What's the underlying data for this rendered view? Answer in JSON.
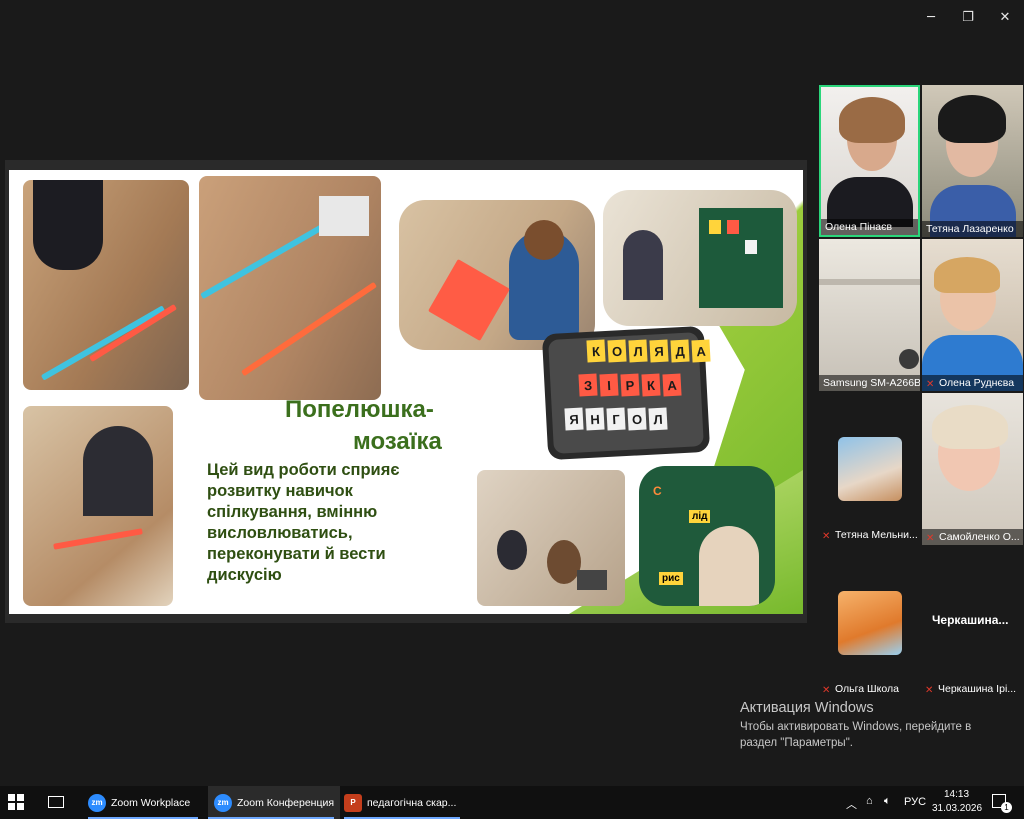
{
  "window": {
    "minimize": "─",
    "maximize": "❐",
    "close": "✕"
  },
  "slide": {
    "title_line1": "Попелюшка-",
    "title_line2": "мозаїка",
    "body_lines": [
      "Цей вид роботи  сприяє",
      "розвитку навичок",
      "спілкування, вмінню",
      "висловлюватись,",
      "переконувати й вести",
      "дискусію"
    ],
    "board_row1": [
      "К",
      "О",
      "Л",
      "Я",
      "Д",
      "А"
    ],
    "board_row2": [
      "З",
      "І",
      "Р",
      "К",
      "А"
    ],
    "board_row3": [
      "Я",
      "Н",
      "Г",
      "О",
      "Л"
    ],
    "green_board_words": [
      "С",
      "лід",
      "рис"
    ]
  },
  "participants": {
    "p1": "Олена Пінаєв",
    "p2": "Тетяна Лазаренко",
    "p3": "Samsung SM-A266B",
    "p4": "Олена Руднєва",
    "p5": "Тетяна Мельни...",
    "p6": "Самойленко О...",
    "p7": "Ольга Школа",
    "p8_big": "Черкашина...",
    "p8": "Черкашина Ірі..."
  },
  "watermark": {
    "title": "Активация Windows",
    "line1": "Чтобы активировать Windows, перейдите в",
    "line2": "раздел \"Параметры\"."
  },
  "taskbar": {
    "app1": "Zoom Workplace",
    "app2": "Zoom Конференция",
    "app3": "педагогічна скар...",
    "zoom_icon": "zm",
    "ppt_icon": "P",
    "lang": "РУС",
    "time": "14:13",
    "date": "31.03.2026",
    "notif_count": "1"
  },
  "colors": {
    "accent_green": "#7dc22c",
    "title_green": "#3b6f1d",
    "active_speaker": "#2bd67b"
  }
}
